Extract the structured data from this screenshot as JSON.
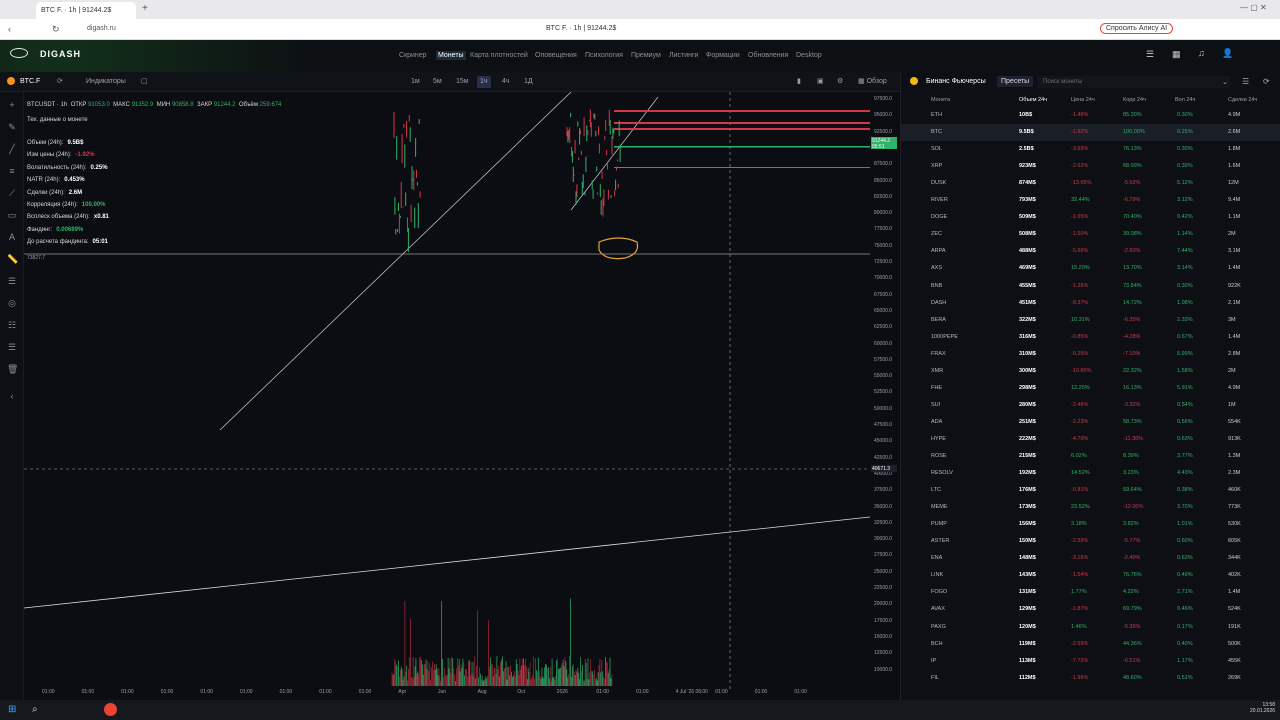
{
  "browser": {
    "tab_title": "BTC F. · 1h | 91244.2$",
    "url": "digash.ru",
    "page_title": "BTC F. · 1h | 91244.2$",
    "alice": "Спросить Алису AI"
  },
  "app": {
    "logo": "DIGASH",
    "nav": [
      "Скринер",
      "Монеты",
      "Карта плотностей",
      "Оповещения",
      "Психология",
      "Премиум",
      "Листинги",
      "Формации",
      "Обновления",
      "Desktop"
    ]
  },
  "toolbar": {
    "symbol": "BTC.F",
    "indicators": "Индикаторы",
    "timeframes": [
      "1м",
      "5м",
      "15м",
      "1ч",
      "4ч",
      "1Д"
    ],
    "active_tf": "1ч",
    "overview": "Обзор"
  },
  "chart_header": {
    "pair": "BTCUSDT · 1h",
    "open_label": "ОТКР",
    "open": "91053.0",
    "high_label": "МАКС",
    "high": "91352.9",
    "low_label": "МИН",
    "low": "90858.8",
    "close_label": "ЗАКР",
    "close": "91244.2",
    "vol_label": "Объём",
    "vol": "259.674",
    "tech_data": "Тех. данные о монете",
    "rows": [
      {
        "label": "Объем (24h):",
        "value": "9.5B$",
        "color": "#ffffff"
      },
      {
        "label": "Изм цены (24h):",
        "value": "-1.92%",
        "color": "#d0394b"
      },
      {
        "label": "Волатильность (24h):",
        "value": "0.25%",
        "color": "#ffffff"
      },
      {
        "label": "NATR (24h):",
        "value": "0.453%",
        "color": "#ffffff"
      },
      {
        "label": "Сделки (24h):",
        "value": "2.6M",
        "color": "#ffffff"
      },
      {
        "label": "Корреляция (24h):",
        "value": "100.00%",
        "color": "#2fb36a"
      },
      {
        "label": "Всплеск объема (24h):",
        "value": "x0.81",
        "color": "#ffffff"
      },
      {
        "label": "Фандинг:",
        "value": "0.00689%",
        "color": "#2fb36a"
      },
      {
        "label": "До расчета фандинга:",
        "value": "05:01",
        "color": "#ffffff"
      }
    ],
    "level_label": "73827.7"
  },
  "price_axis": [
    "97500.0",
    "95000.0",
    "92500.0",
    "90000.0",
    "87500.0",
    "85000.0",
    "82500.0",
    "80000.0",
    "77500.0",
    "75000.0",
    "72500.0",
    "70000.0",
    "67500.0",
    "65000.0",
    "62500.0",
    "60000.0",
    "57500.0",
    "55000.0",
    "52500.0",
    "50000.0",
    "47500.0",
    "45000.0",
    "42500.0",
    "40000.0",
    "37500.0",
    "35000.0",
    "32500.0",
    "30000.0",
    "27500.0",
    "25000.0",
    "22500.0",
    "20000.0",
    "17500.0",
    "15000.0",
    "12500.0",
    "10000.0"
  ],
  "current_price": "91244.2",
  "current_time": "05:51",
  "cursor_price": "40671.3",
  "time_axis": [
    "01:00",
    "01:00",
    "01:00",
    "01:00",
    "01:00",
    "01:00",
    "01:00",
    "01:00",
    "01:00",
    "Apr",
    "Jun",
    "Aug",
    "Oct",
    "2026",
    "01:00",
    "01:00",
    "4 Jul '26 08:00",
    "01:00",
    "01:00",
    "01:00"
  ],
  "right_panel": {
    "title": "Бинанс Фьючерсы",
    "presets": "Пресеты",
    "search_placeholder": "Поиск монеты",
    "headers": [
      "Монета",
      "Объем 24ч",
      "Цена 24ч",
      "Корр 24ч",
      "Вол 24ч",
      "Сделки 24ч"
    ],
    "rows": [
      [
        "ETH",
        "10B$",
        "-1.46%",
        "85.30%",
        "0.30%",
        "4.9M"
      ],
      [
        "BTC",
        "9.5B$",
        "-1.92%",
        "100.00%",
        "0.25%",
        "2.6M"
      ],
      [
        "SOL",
        "2.5B$",
        "-3.69%",
        "76.13%",
        "0.30%",
        "1.8M"
      ],
      [
        "XRP",
        "923M$",
        "-2.62%",
        "68.09%",
        "0.39%",
        "1.6M"
      ],
      [
        "DUSK",
        "874M$",
        "-13.65%",
        "-5.62%",
        "5.12%",
        "12M"
      ],
      [
        "RIVER",
        "793M$",
        "32.44%",
        "-6.79%",
        "3.12%",
        "9.4M"
      ],
      [
        "DOGE",
        "509M$",
        "-1.65%",
        "70.40%",
        "0.42%",
        "1.1M"
      ],
      [
        "ZEC",
        "508M$",
        "-1.50%",
        "39.08%",
        "1.14%",
        "2M"
      ],
      [
        "ARPA",
        "488M$",
        "-5.66%",
        "-2.60%",
        "7.44%",
        "3.1M"
      ],
      [
        "AXS",
        "469M$",
        "15.29%",
        "13.70%",
        "3.14%",
        "1.4M"
      ],
      [
        "BNB",
        "455M$",
        "-1.26%",
        "73.84%",
        "0.30%",
        "922K"
      ],
      [
        "DASH",
        "451M$",
        "-8.37%",
        "14.72%",
        "1.08%",
        "2.1M"
      ],
      [
        "BERA",
        "322M$",
        "10.31%",
        "-6.35%",
        "2.33%",
        "3M"
      ],
      [
        "1000PEPE",
        "316M$",
        "-0.85%",
        "-4.28%",
        "0.67%",
        "1.4M"
      ],
      [
        "FRAX",
        "310M$",
        "-0.25%",
        "-7.10%",
        "5.99%",
        "2.8M"
      ],
      [
        "XMR",
        "300M$",
        "-10.80%",
        "22.32%",
        "1.58%",
        "2M"
      ],
      [
        "FHE",
        "298M$",
        "12.25%",
        "16.13%",
        "5.91%",
        "4.9M"
      ],
      [
        "SUI",
        "280M$",
        "-2.46%",
        "-3.32%",
        "0.54%",
        "1M"
      ],
      [
        "ADA",
        "251M$",
        "-2.23%",
        "58.73%",
        "0.56%",
        "554K"
      ],
      [
        "HYPE",
        "222M$",
        "-4.70%",
        "-11.36%",
        "0.63%",
        "913K"
      ],
      [
        "ROSE",
        "215M$",
        "6.02%",
        "8.39%",
        "3.77%",
        "1.3M"
      ],
      [
        "RESOLV",
        "192M$",
        "14.52%",
        "3.23%",
        "4.43%",
        "2.3M"
      ],
      [
        "LTC",
        "176M$",
        "-0.81%",
        "59.64%",
        "0.38%",
        "460K"
      ],
      [
        "MEME",
        "173M$",
        "23.52%",
        "-12.00%",
        "3.70%",
        "773K"
      ],
      [
        "PUMP",
        "156M$",
        "3.18%",
        "3.82%",
        "1.01%",
        "530K"
      ],
      [
        "ASTER",
        "150M$",
        "-2.59%",
        "-5.77%",
        "0.60%",
        "605K"
      ],
      [
        "ENA",
        "148M$",
        "-3.16%",
        "-2.40%",
        "0.63%",
        "344K"
      ],
      [
        "LINK",
        "143M$",
        "-1.54%",
        "76.76%",
        "0.49%",
        "402K"
      ],
      [
        "FOGO",
        "131M$",
        "1.77%",
        "4.22%",
        "2.71%",
        "1.4M"
      ],
      [
        "AVAX",
        "129M$",
        "-1.87%",
        "69.79%",
        "0.46%",
        "524K"
      ],
      [
        "PAXG",
        "120M$",
        "1.46%",
        "-5.36%",
        "0.17%",
        "191K"
      ],
      [
        "BCH",
        "119M$",
        "-2.59%",
        "44.36%",
        "0.40%",
        "500K"
      ],
      [
        "IP",
        "113M$",
        "-7.72%",
        "-6.51%",
        "1.17%",
        "455K"
      ],
      [
        "FIL",
        "112M$",
        "-1.96%",
        "48.60%",
        "0.51%",
        "269K"
      ]
    ]
  },
  "taskbar": {
    "time": "13:58",
    "date": "20.01.2026"
  }
}
